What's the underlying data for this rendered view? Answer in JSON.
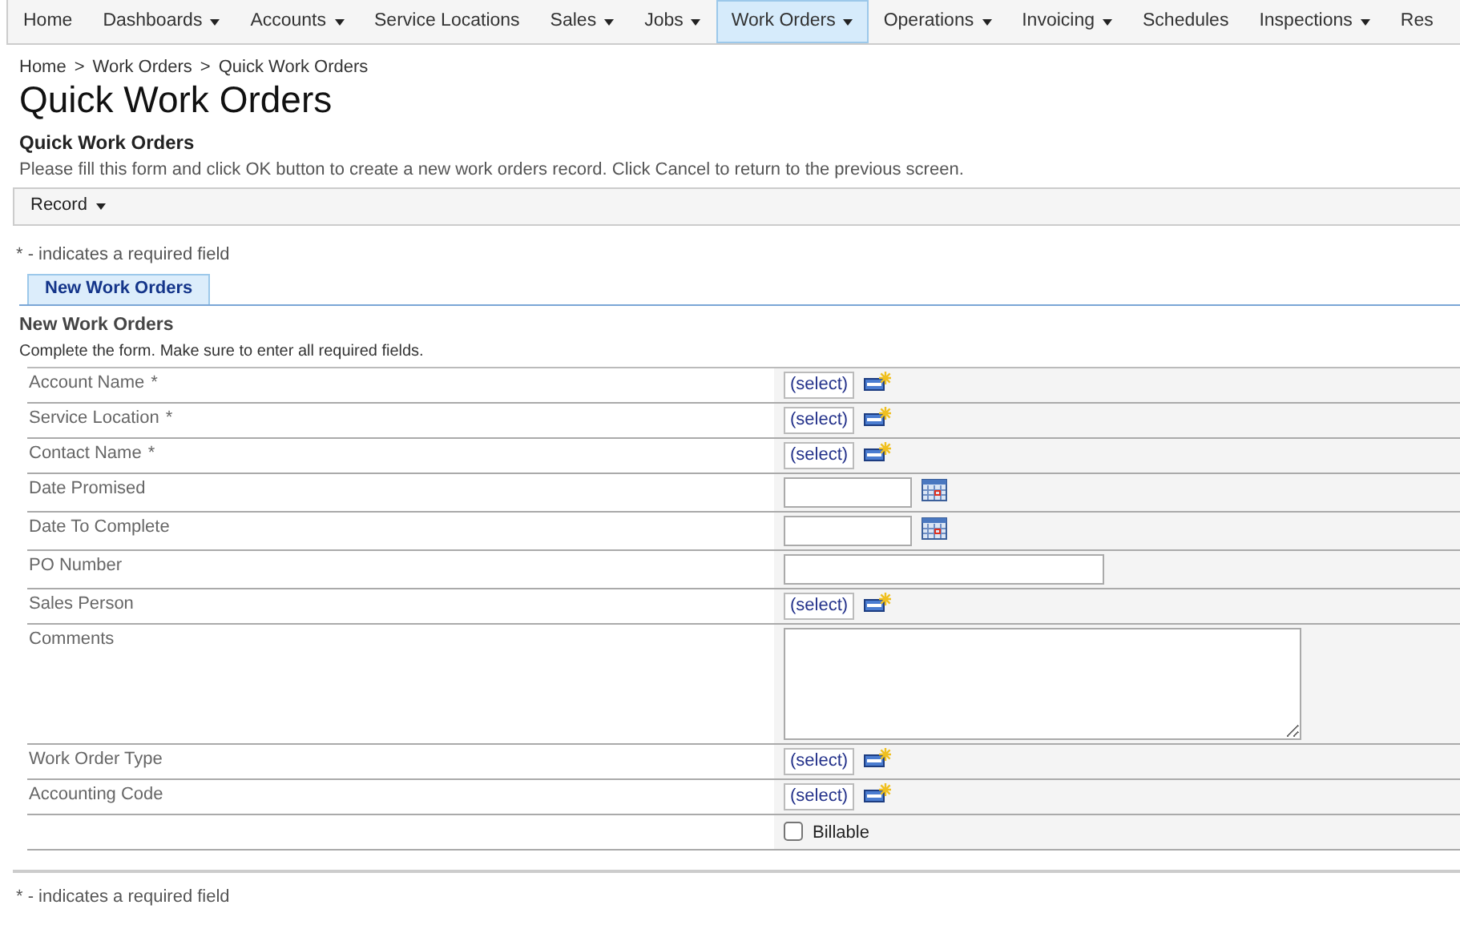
{
  "nav": [
    {
      "label": "Home",
      "dropdown": false,
      "selected": false
    },
    {
      "label": "Dashboards",
      "dropdown": true,
      "selected": false
    },
    {
      "label": "Accounts",
      "dropdown": true,
      "selected": false
    },
    {
      "label": "Service Locations",
      "dropdown": false,
      "selected": false
    },
    {
      "label": "Sales",
      "dropdown": true,
      "selected": false
    },
    {
      "label": "Jobs",
      "dropdown": true,
      "selected": false
    },
    {
      "label": "Work Orders",
      "dropdown": true,
      "selected": true
    },
    {
      "label": "Operations",
      "dropdown": true,
      "selected": false
    },
    {
      "label": "Invoicing",
      "dropdown": true,
      "selected": false
    },
    {
      "label": "Schedules",
      "dropdown": false,
      "selected": false
    },
    {
      "label": "Inspections",
      "dropdown": true,
      "selected": false
    },
    {
      "label": "Res",
      "dropdown": false,
      "selected": false
    }
  ],
  "breadcrumb": [
    {
      "label": "Home",
      "separator": ">"
    },
    {
      "label": "Work Orders",
      "separator": ">"
    },
    {
      "label": "Quick Work Orders"
    }
  ],
  "page_title": "Quick Work Orders",
  "form_title": "Quick Work Orders",
  "instructions": "Please fill this form and click OK button to create a new work orders record. Click Cancel to return to the previous screen.",
  "toolbar": {
    "label": "Record",
    "dropdown": true
  },
  "required_note_top": "* - indicates a required field",
  "tabs": [
    {
      "label": "New Work Orders",
      "selected": true
    }
  ],
  "section": {
    "title": "New Work Orders",
    "subtitle": "Complete the form. Make sure to enter all required fields."
  },
  "fields": [
    {
      "kind": "select",
      "label": "Account Name",
      "mark": "*",
      "value": "(select)"
    },
    {
      "kind": "select",
      "label": "Service Location",
      "mark": "*",
      "value": "(select)"
    },
    {
      "kind": "select",
      "label": "Contact Name",
      "mark": "*",
      "value": "(select)"
    },
    {
      "kind": "date",
      "label": "Date Promised"
    },
    {
      "kind": "date",
      "label": "Date To Complete"
    },
    {
      "kind": "text",
      "label": "PO Number"
    },
    {
      "kind": "select",
      "label": "Sales Person",
      "value": "(select)"
    },
    {
      "kind": "textarea",
      "label": "Comments"
    },
    {
      "kind": "select",
      "label": "Work Order Type",
      "value": "(select)"
    },
    {
      "kind": "select",
      "label": "Accounting Code",
      "value": "(select)"
    },
    {
      "kind": "checkbox",
      "label": "Billable",
      "checked": false
    }
  ],
  "required_note_bottom": "* - indicates a required field"
}
